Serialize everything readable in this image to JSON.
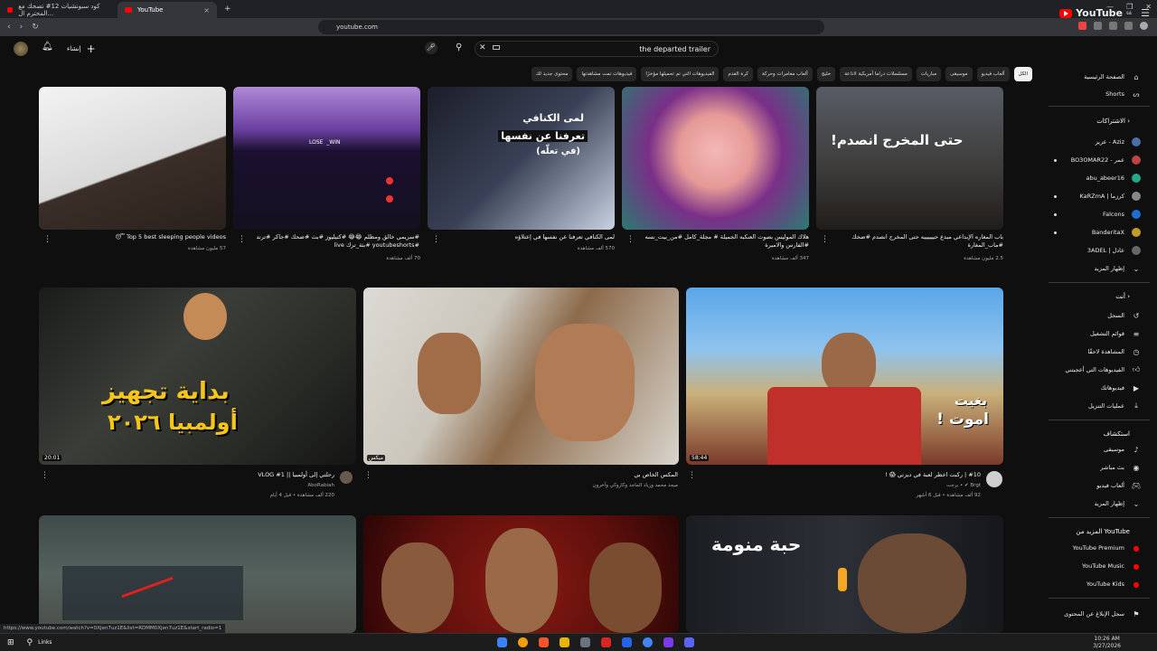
{
  "browser": {
    "tabs": [
      {
        "label": "كود سبونشيات 12# تصحك مع المحترم ال..."
      },
      {
        "label": "YouTube"
      }
    ],
    "new_tab": "+",
    "url": "youtube.com",
    "status_url": "https://www.youtube.com/watch?v=0Xjen7uz1E&list=RDMM0Xjen7uz1E&start_radio=1"
  },
  "header": {
    "logo_text": "YouTube",
    "logo_sup": "SA",
    "search_query": "the departed trailer",
    "create_label": "إنشاء"
  },
  "chips": [
    {
      "label": "الكل",
      "active": true
    },
    {
      "label": "ألعاب فيديو"
    },
    {
      "label": "موسيقى"
    },
    {
      "label": "مباريات"
    },
    {
      "label": "مسلسلات دراما أمريكية لاذاعة"
    },
    {
      "label": "خليج"
    },
    {
      "label": "ألعاب مغامرات وحركة"
    },
    {
      "label": "كرة القدم"
    },
    {
      "label": "الفيديوهات التي تم تحميلها مؤخرًا"
    },
    {
      "label": "فيديوهات تمت مشاهدتها"
    },
    {
      "label": "محتوى جديد لك"
    }
  ],
  "sidebar": {
    "home": "الصفحة الرئيسية",
    "shorts": "Shorts",
    "subscriptions_head": "الاشتراكات",
    "subscriptions": [
      {
        "name": "عزيز - Aziz",
        "color": "#4a6fa5"
      },
      {
        "name": "BO3OMAR22 - عمر",
        "color": "#b44"
      },
      {
        "name": "abu_abeer16",
        "color": "#2a8"
      },
      {
        "name": "KaRZmA | كرزما",
        "color": "#888"
      },
      {
        "name": "Falcons",
        "color": "#1c6ed1"
      },
      {
        "name": "BanderitaX",
        "color": "#c29a2a"
      },
      {
        "name": "3ADEL | عادل",
        "color": "#666"
      }
    ],
    "show_more": "إظهار المزيد",
    "you_head": "أنت",
    "you_items": [
      "السجل",
      "قوائم التشغيل",
      "المشاهدة لاحقًا",
      "الفيديوهات التي أعجبتني",
      "فيديوهاتك",
      "عمليات التنزيل"
    ],
    "explore_head": "استكشاف",
    "explore_items": [
      "موسيقى",
      "بث مباشر",
      "ألعاب فيديو",
      "إظهار المزيد"
    ],
    "more_head": "المزيد من YouTube",
    "more_items": [
      "YouTube Premium",
      "YouTube Music",
      "YouTube Kids"
    ],
    "report": "سجل الإبلاغ عن المحتوى"
  },
  "shorts": [
    {
      "title": "Top 5 best sleeping people videos 😴",
      "views": "57 مليون مشاهدة"
    },
    {
      "title": "#سريمي خالق ومظلم 😂😂 #كتيليوز #بث #ضحك #جاكر #ترند #youtubeshorts #بثة_ترك live",
      "views": ""
    },
    {
      "title": "لمى الكنافي تعرفنا عن نفسها في إعتلاؤه",
      "views": "570 ألف مشاهدة",
      "overlay": [
        "لمى الكنافي",
        "تعرفنا عن نفسها",
        "(في تعلّه)"
      ]
    },
    {
      "title": "هلاك الموليس بصوت العنكبه الجميلة # مجلة_كامل #من_بيت_نسه #الفارس والاميرة",
      "views": "347 ألف مشاهدة"
    },
    {
      "title": "باب المغاره الإبداعي مبدع حييييييه حتى المخرج انصدم #ضحك #ماب_المغارة",
      "views": "2.5 مليون مشاهدة",
      "overlay": [
        "حتى المخرج انصدم!"
      ]
    }
  ],
  "shorts_extra_meta": "70 ألف مشاهدة",
  "videos_row1": [
    {
      "title": "رحلتي إلى أولمبيا || VLOG #1",
      "channel": "AboRabiah",
      "meta": "220 ألف مشاهدة • قبل 4 أيام",
      "duration": "20:01",
      "overlay": [
        "بداية تجهيز",
        "أولمبيا ٢٠٢٦"
      ]
    },
    {
      "title": "المكس الخاص بي",
      "channel": "ميكس",
      "meta": "ميجد محمد وزياد الماجد وكاروكي وآخرون",
      "duration": "ميكس",
      "overlay": []
    },
    {
      "title": "#10 | ركبت اخطر لعبة في ديزني 😱 !",
      "channel": "Brgt ✔ • برجت",
      "meta": "92 ألف مشاهدة • قبل 6 أشهر",
      "duration": "58:44",
      "overlay": [
        "بغيت",
        "اموت !"
      ]
    }
  ],
  "videos_row2": [
    {
      "overlay": []
    },
    {
      "overlay": []
    },
    {
      "overlay": [
        "حبة منومة"
      ]
    }
  ],
  "taskbar": {
    "search": "Links",
    "time": "10:26 AM",
    "date": "3/27/2026"
  }
}
